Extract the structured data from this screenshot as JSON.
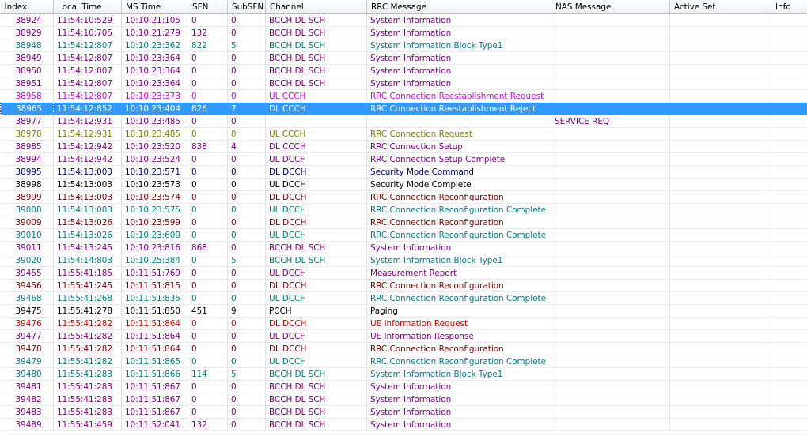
{
  "columns": [
    "Index",
    "Local Time",
    "MS Time",
    "SFN",
    "SubSFN",
    "Channel",
    "RRC Message",
    "NAS Message",
    "Active Set",
    "Info"
  ],
  "colors": {
    "bcch": "#800080",
    "bcch_sib1": "#008080",
    "ccch_pink": "#e000e0",
    "olive": "#808000",
    "maroon": "#800000",
    "teal": "#008080",
    "navy": "#000080",
    "black": "#000000",
    "red": "#e00000",
    "purple": "#800080",
    "selected": "#3399ff"
  },
  "rows": [
    {
      "index": "38924",
      "local": "11:54:10:529",
      "ms": "10:10:21:105",
      "sfn": "0",
      "sub": "0",
      "channel": "BCCH DL SCH",
      "rrc": "System Information",
      "nas": "",
      "color": "bcch"
    },
    {
      "index": "38929",
      "local": "11:54:10:705",
      "ms": "10:10:21:279",
      "sfn": "132",
      "sub": "0",
      "channel": "BCCH DL SCH",
      "rrc": "System Information",
      "nas": "",
      "color": "bcch"
    },
    {
      "index": "38948",
      "local": "11:54:12:807",
      "ms": "10:10:23:362",
      "sfn": "822",
      "sub": "5",
      "channel": "BCCH DL SCH",
      "rrc": "System Information Block Type1",
      "nas": "",
      "color": "bcch_sib1"
    },
    {
      "index": "38949",
      "local": "11:54:12:807",
      "ms": "10:10:23:364",
      "sfn": "0",
      "sub": "0",
      "channel": "BCCH DL SCH",
      "rrc": "System Information",
      "nas": "",
      "color": "bcch"
    },
    {
      "index": "38950",
      "local": "11:54:12:807",
      "ms": "10:10:23:364",
      "sfn": "0",
      "sub": "0",
      "channel": "BCCH DL SCH",
      "rrc": "System Information",
      "nas": "",
      "color": "bcch"
    },
    {
      "index": "38951",
      "local": "11:54:12:807",
      "ms": "10:10:23:364",
      "sfn": "0",
      "sub": "0",
      "channel": "BCCH DL SCH",
      "rrc": "System Information",
      "nas": "",
      "color": "bcch"
    },
    {
      "index": "38958",
      "local": "11:54:12:807",
      "ms": "10:10:23:373",
      "sfn": "0",
      "sub": "0",
      "channel": "UL CCCH",
      "rrc": "RRC Connection Reestablishment Request",
      "nas": "",
      "color": "ccch_pink"
    },
    {
      "index": "38965",
      "local": "11:54:12:852",
      "ms": "10:10:23:404",
      "sfn": "826",
      "sub": "7",
      "channel": "DL CCCH",
      "rrc": "RRC Connection Reestablishment Reject",
      "nas": "",
      "color": "black",
      "selected": true
    },
    {
      "index": "38977",
      "local": "11:54:12:931",
      "ms": "10:10:23:485",
      "sfn": "0",
      "sub": "0",
      "channel": "",
      "rrc": "",
      "nas": "SERVICE REQ",
      "color": "purple"
    },
    {
      "index": "38978",
      "local": "11:54:12:931",
      "ms": "10:10:23:485",
      "sfn": "0",
      "sub": "0",
      "channel": "UL CCCH",
      "rrc": "RRC Connection Request",
      "nas": "",
      "color": "olive"
    },
    {
      "index": "38985",
      "local": "11:54:12:942",
      "ms": "10:10:23:520",
      "sfn": "838",
      "sub": "4",
      "channel": "DL CCCH",
      "rrc": "RRC Connection Setup",
      "nas": "",
      "color": "purple"
    },
    {
      "index": "38994",
      "local": "11:54:12:942",
      "ms": "10:10:23:524",
      "sfn": "0",
      "sub": "0",
      "channel": "UL DCCH",
      "rrc": "RRC Connection Setup Complete",
      "nas": "",
      "color": "purple"
    },
    {
      "index": "38995",
      "local": "11:54:13:003",
      "ms": "10:10:23:571",
      "sfn": "0",
      "sub": "0",
      "channel": "DL DCCH",
      "rrc": "Security Mode Command",
      "nas": "",
      "color": "navy"
    },
    {
      "index": "38998",
      "local": "11:54:13:003",
      "ms": "10:10:23:573",
      "sfn": "0",
      "sub": "0",
      "channel": "UL DCCH",
      "rrc": "Security Mode Complete",
      "nas": "",
      "color": "black"
    },
    {
      "index": "38999",
      "local": "11:54:13:003",
      "ms": "10:10:23:574",
      "sfn": "0",
      "sub": "0",
      "channel": "DL DCCH",
      "rrc": "RRC Connection Reconfiguration",
      "nas": "",
      "color": "maroon"
    },
    {
      "index": "39008",
      "local": "11:54:13:003",
      "ms": "10:10:23:575",
      "sfn": "0",
      "sub": "0",
      "channel": "UL DCCH",
      "rrc": "RRC Connection Reconfiguration Complete",
      "nas": "",
      "color": "teal"
    },
    {
      "index": "39009",
      "local": "11:54:13:026",
      "ms": "10:10:23:599",
      "sfn": "0",
      "sub": "0",
      "channel": "DL DCCH",
      "rrc": "RRC Connection Reconfiguration",
      "nas": "",
      "color": "maroon"
    },
    {
      "index": "39010",
      "local": "11:54:13:026",
      "ms": "10:10:23:600",
      "sfn": "0",
      "sub": "0",
      "channel": "UL DCCH",
      "rrc": "RRC Connection Reconfiguration Complete",
      "nas": "",
      "color": "teal"
    },
    {
      "index": "39011",
      "local": "11:54:13:245",
      "ms": "10:10:23:816",
      "sfn": "868",
      "sub": "0",
      "channel": "BCCH DL SCH",
      "rrc": "System Information",
      "nas": "",
      "color": "bcch"
    },
    {
      "index": "39020",
      "local": "11:54:14:803",
      "ms": "10:10:25:384",
      "sfn": "0",
      "sub": "5",
      "channel": "BCCH DL SCH",
      "rrc": "System Information Block Type1",
      "nas": "",
      "color": "bcch_sib1"
    },
    {
      "index": "39455",
      "local": "11:55:41:185",
      "ms": "10:11:51:769",
      "sfn": "0",
      "sub": "0",
      "channel": "UL DCCH",
      "rrc": "Measurement Report",
      "nas": "",
      "color": "purple"
    },
    {
      "index": "39456",
      "local": "11:55:41:245",
      "ms": "10:11:51:815",
      "sfn": "0",
      "sub": "0",
      "channel": "DL DCCH",
      "rrc": "RRC Connection Reconfiguration",
      "nas": "",
      "color": "maroon"
    },
    {
      "index": "39468",
      "local": "11:55:41:268",
      "ms": "10:11:51:835",
      "sfn": "0",
      "sub": "0",
      "channel": "UL DCCH",
      "rrc": "RRC Connection Reconfiguration Complete",
      "nas": "",
      "color": "teal"
    },
    {
      "index": "39475",
      "local": "11:55:41:278",
      "ms": "10:11:51:850",
      "sfn": "451",
      "sub": "9",
      "channel": "PCCH",
      "rrc": "Paging",
      "nas": "",
      "color": "black"
    },
    {
      "index": "39476",
      "local": "11:55:41:282",
      "ms": "10:11:51:864",
      "sfn": "0",
      "sub": "0",
      "channel": "DL DCCH",
      "rrc": "UE Information Request",
      "nas": "",
      "color": "red"
    },
    {
      "index": "39477",
      "local": "11:55:41:282",
      "ms": "10:11:51:864",
      "sfn": "0",
      "sub": "0",
      "channel": "UL DCCH",
      "rrc": "UE Information Response",
      "nas": "",
      "color": "purple"
    },
    {
      "index": "39478",
      "local": "11:55:41:282",
      "ms": "10:11:51:864",
      "sfn": "0",
      "sub": "0",
      "channel": "DL DCCH",
      "rrc": "RRC Connection Reconfiguration",
      "nas": "",
      "color": "maroon"
    },
    {
      "index": "39479",
      "local": "11:55:41:282",
      "ms": "10:11:51:865",
      "sfn": "0",
      "sub": "0",
      "channel": "UL DCCH",
      "rrc": "RRC Connection Reconfiguration Complete",
      "nas": "",
      "color": "teal"
    },
    {
      "index": "39480",
      "local": "11:55:41:283",
      "ms": "10:11:51:866",
      "sfn": "114",
      "sub": "5",
      "channel": "BCCH DL SCH",
      "rrc": "System Information Block Type1",
      "nas": "",
      "color": "bcch_sib1"
    },
    {
      "index": "39481",
      "local": "11:55:41:283",
      "ms": "10:11:51:867",
      "sfn": "0",
      "sub": "0",
      "channel": "BCCH DL SCH",
      "rrc": "System Information",
      "nas": "",
      "color": "bcch"
    },
    {
      "index": "39482",
      "local": "11:55:41:283",
      "ms": "10:11:51:867",
      "sfn": "0",
      "sub": "0",
      "channel": "BCCH DL SCH",
      "rrc": "System Information",
      "nas": "",
      "color": "bcch"
    },
    {
      "index": "39483",
      "local": "11:55:41:283",
      "ms": "10:11:51:867",
      "sfn": "0",
      "sub": "0",
      "channel": "BCCH DL SCH",
      "rrc": "System Information",
      "nas": "",
      "color": "bcch"
    },
    {
      "index": "39489",
      "local": "11:55:41:459",
      "ms": "10:11:52:041",
      "sfn": "132",
      "sub": "0",
      "channel": "BCCH DL SCH",
      "rrc": "System Information",
      "nas": "",
      "color": "bcch"
    }
  ]
}
